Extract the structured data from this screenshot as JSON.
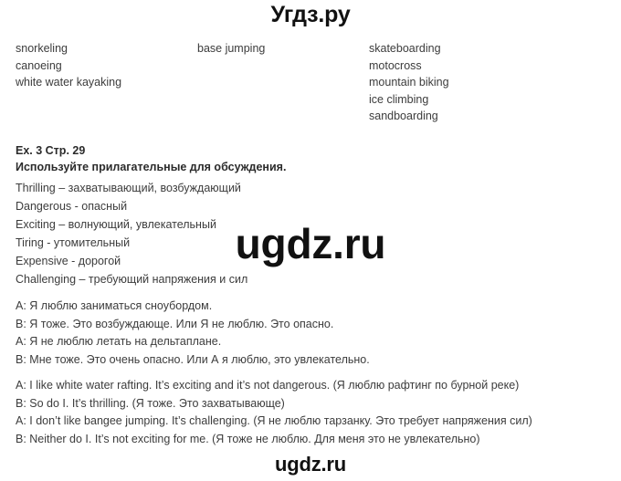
{
  "watermarks": {
    "top": "Угдз.ру",
    "middle": "ugdz.ru",
    "bottom": "ugdz.ru"
  },
  "wordlist": {
    "column1": [
      "snorkeling",
      "canoeing",
      "white water kayaking"
    ],
    "column2": [
      "base jumping"
    ],
    "column3": [
      "skateboarding",
      "motocross",
      "mountain biking",
      "ice climbing",
      "sandboarding"
    ]
  },
  "exercise": {
    "title": "Ex. 3 Стр. 29",
    "subtitle": "Используйте прилагательные для обсуждения.",
    "adjectives": [
      "Thrilling – захватывающий, возбуждающий",
      "Dangerous - опасный",
      "Exciting – волнующий, увлекательный",
      "Tiring - утомительный",
      "Expensive - дорогой",
      "Challenging – требующий напряжения и сил"
    ]
  },
  "dialogue_ru": [
    "A: Я люблю заниматься сноубордом.",
    "B: Я тоже. Это возбуждающе. Или Я не люблю. Это опасно.",
    "A: Я не люблю летать на дельтаплане.",
    "B: Мне тоже. Это очень опасно. Или А я люблю, это увлекательно."
  ],
  "dialogue_en": [
    "A: I like white water rafting. It’s exciting and it’s not dangerous. (Я люблю рафтинг по бурной реке)",
    "B: So do I. It’s thrilling. (Я тоже. Это захватывающе)",
    "A: I don’t like bangee jumping. It’s challenging. (Я не люблю тарзанку. Это требует напряжения сил)",
    "B: Neither do I. It’s not exciting for me. (Я тоже не люблю. Для меня это не увлекательно)"
  ]
}
